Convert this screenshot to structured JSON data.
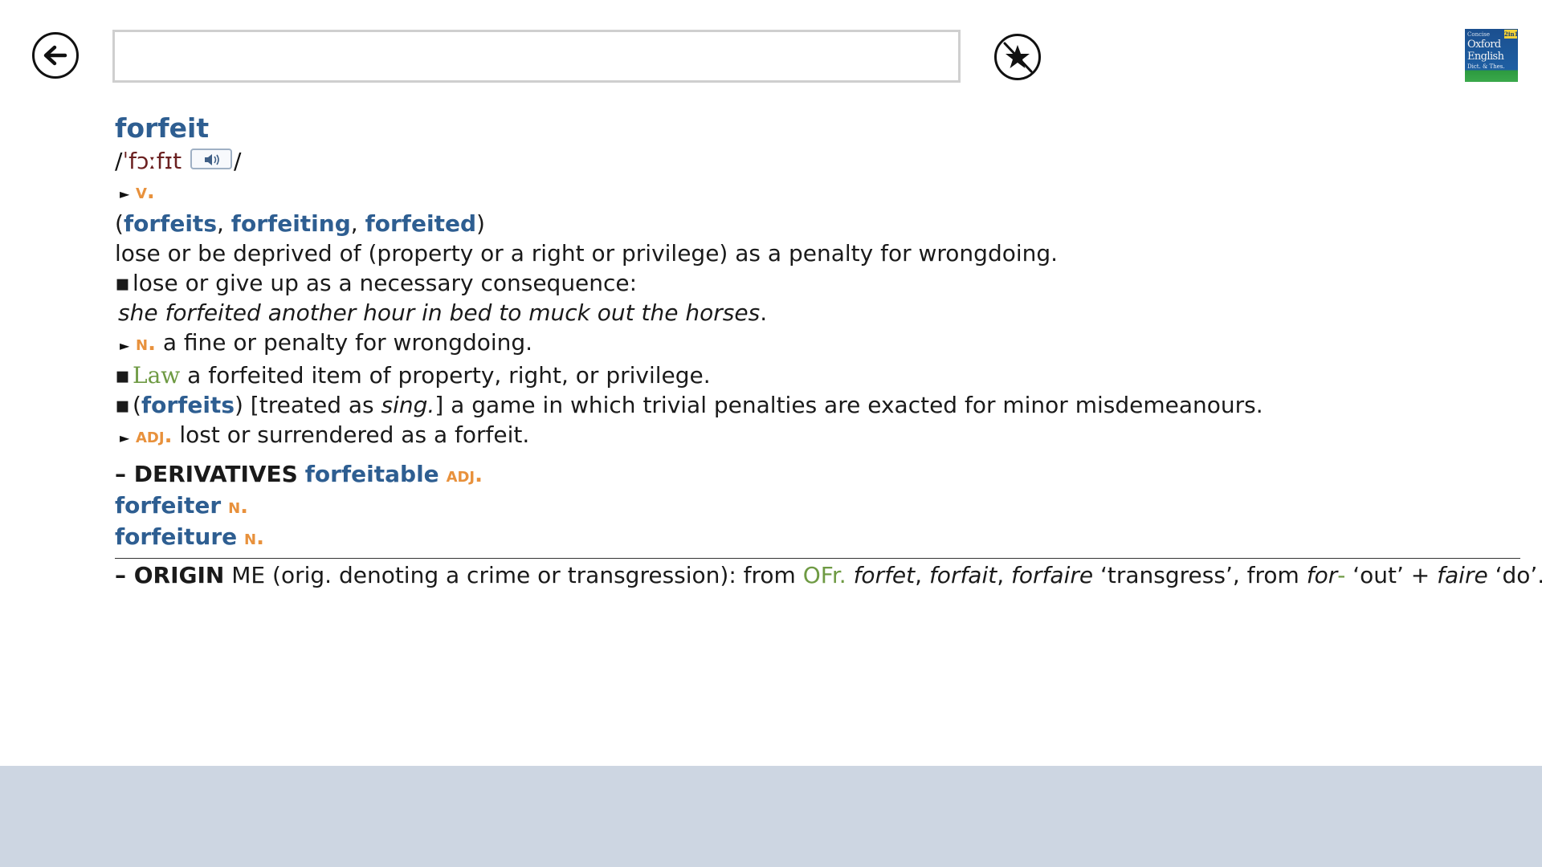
{
  "header": {
    "back_icon": "back-arrow-icon",
    "search": {
      "value": "",
      "placeholder": ""
    },
    "favorite_icon": "star-favorite-icon",
    "logo": {
      "badge": "2in1",
      "line1": "Concise",
      "line2": "Oxford",
      "line3": "English",
      "line4": "Dict. & Thes."
    }
  },
  "entry": {
    "headword": "forfeit",
    "pron_open": "/",
    "pronunciation": "ˈfɔːfɪt",
    "pron_close": "/",
    "audio_icon": "speaker-icon",
    "verb": {
      "pos": "v.",
      "inflections_open": "(",
      "inflections": [
        "forfeits",
        "forfeiting",
        "forfeited"
      ],
      "sep": ", ",
      "inflections_close": ")",
      "definition": "lose or be deprived of (property or a right or privilege) as a penalty for wrongdoing.",
      "sub_bullet": "▪",
      "sub_definition": "lose or give up as a necessary consequence:",
      "example": "she forfeited another hour in bed to muck out the horses",
      "example_end": "."
    },
    "noun": {
      "pos": "n.",
      "definition": "a fine or penalty for wrongdoing.",
      "law_bullet": "▪",
      "law_label": "Law",
      "law_definition": "a forfeited item of property, right, or privilege.",
      "plural_bullet": "▪",
      "plural_open": "(",
      "plural_form": "forfeits",
      "plural_mid": ") [treated as ",
      "plural_sing": "sing.",
      "plural_rest": "] a game in which trivial penalties are exacted for minor misdemeanours."
    },
    "adjective": {
      "pos": "adj.",
      "definition": "lost or surrendered as a forfeit."
    },
    "derivatives": {
      "label": "– DERIVATIVES",
      "items": [
        {
          "word": "forfeitable",
          "pos": "adj."
        },
        {
          "word": "forfeiter",
          "pos": "n."
        },
        {
          "word": "forfeiture",
          "pos": "n."
        }
      ]
    },
    "origin": {
      "label": "– ORIGIN",
      "text1": " ME (orig. denoting a crime or transgression): from ",
      "lang": "OFr.",
      "w1": "forfet",
      "c1": ", ",
      "w2": "forfait",
      "c2": ", ",
      "w3": "forfaire",
      "text2": " ‘transgress’, from ",
      "w4": "for",
      "dash": "-",
      "text3": " ‘out’ + ",
      "w5": "faire",
      "text4": " ‘do’."
    }
  },
  "colors": {
    "headword": "#2e5e91",
    "pos": "#e8913c",
    "label_green": "#6e9a43",
    "pronunciation": "#6b2020",
    "bottom_band": "#cdd6e2"
  }
}
